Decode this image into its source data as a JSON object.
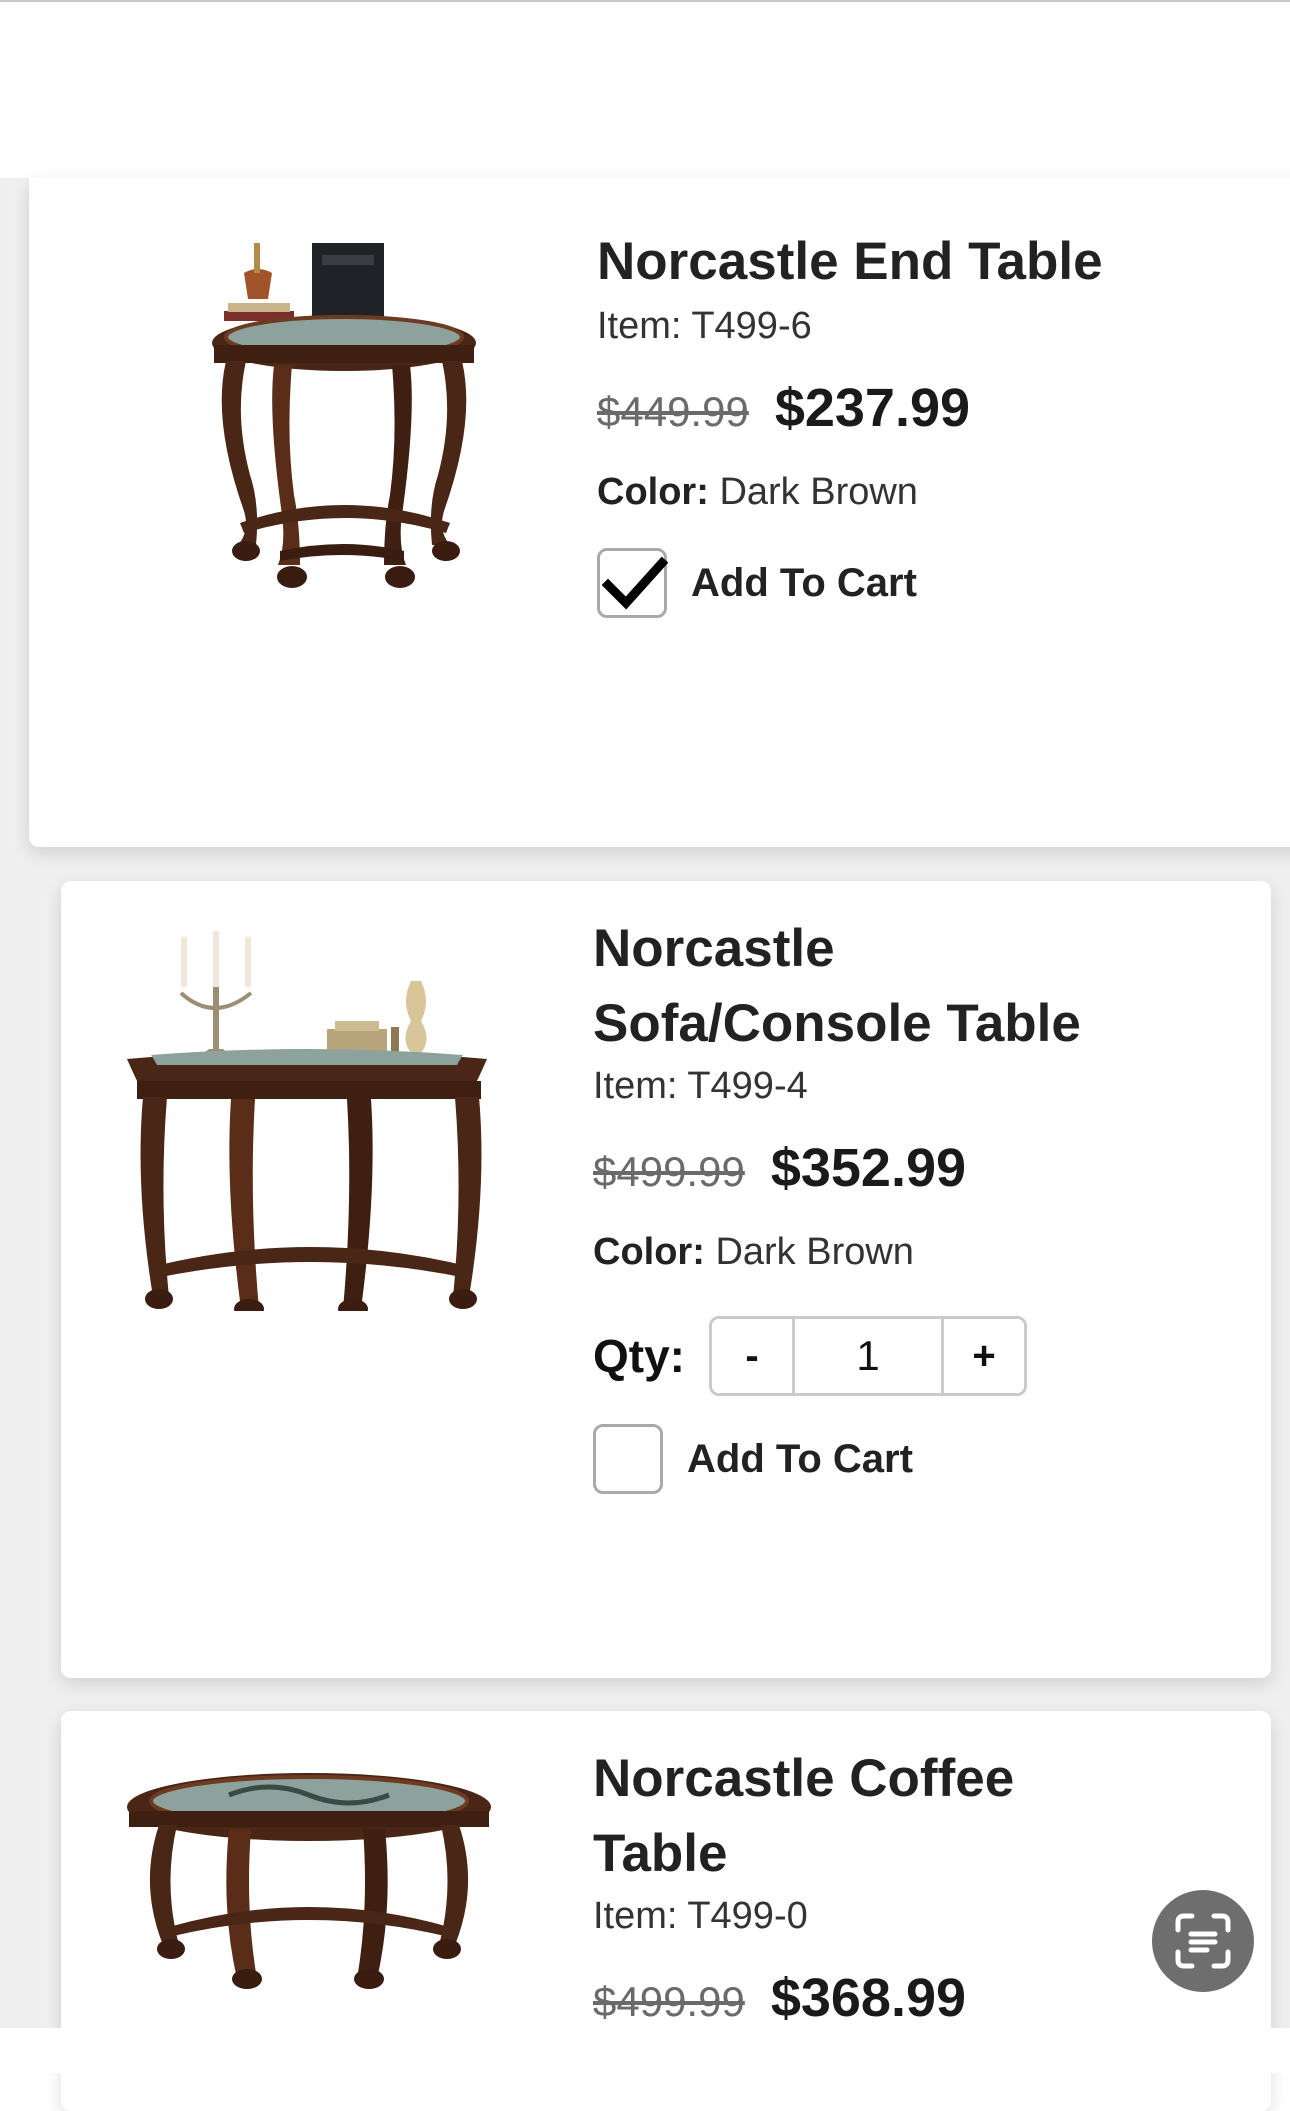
{
  "products": [
    {
      "name": "Norcastle End Table",
      "item": "Item: T499-6",
      "old_price": "$449.99",
      "price": "$237.99",
      "color_label": "Color:",
      "color_value": "Dark Brown",
      "cart_label": "Add To Cart",
      "in_cart": true
    },
    {
      "name": "Norcastle Sofa/Console Table",
      "item": "Item: T499-4",
      "old_price": "$499.99",
      "price": "$352.99",
      "color_label": "Color:",
      "color_value": "Dark Brown",
      "qty_label": "Qty:",
      "qty_minus": "-",
      "qty_value": "1",
      "qty_plus": "+",
      "cart_label": "Add To Cart",
      "in_cart": false
    },
    {
      "name": "Norcastle Coffee Table",
      "item": "Item: T499-0",
      "old_price": "$499.99",
      "price": "$368.99"
    }
  ],
  "fab": {
    "icon": "scan-text-icon"
  },
  "colors": {
    "wood": "#4a2616",
    "wood_light": "#6e3a22",
    "glass": "#9fb3ad",
    "backdrop": "#efefef",
    "fab": "#6e6e6e"
  }
}
